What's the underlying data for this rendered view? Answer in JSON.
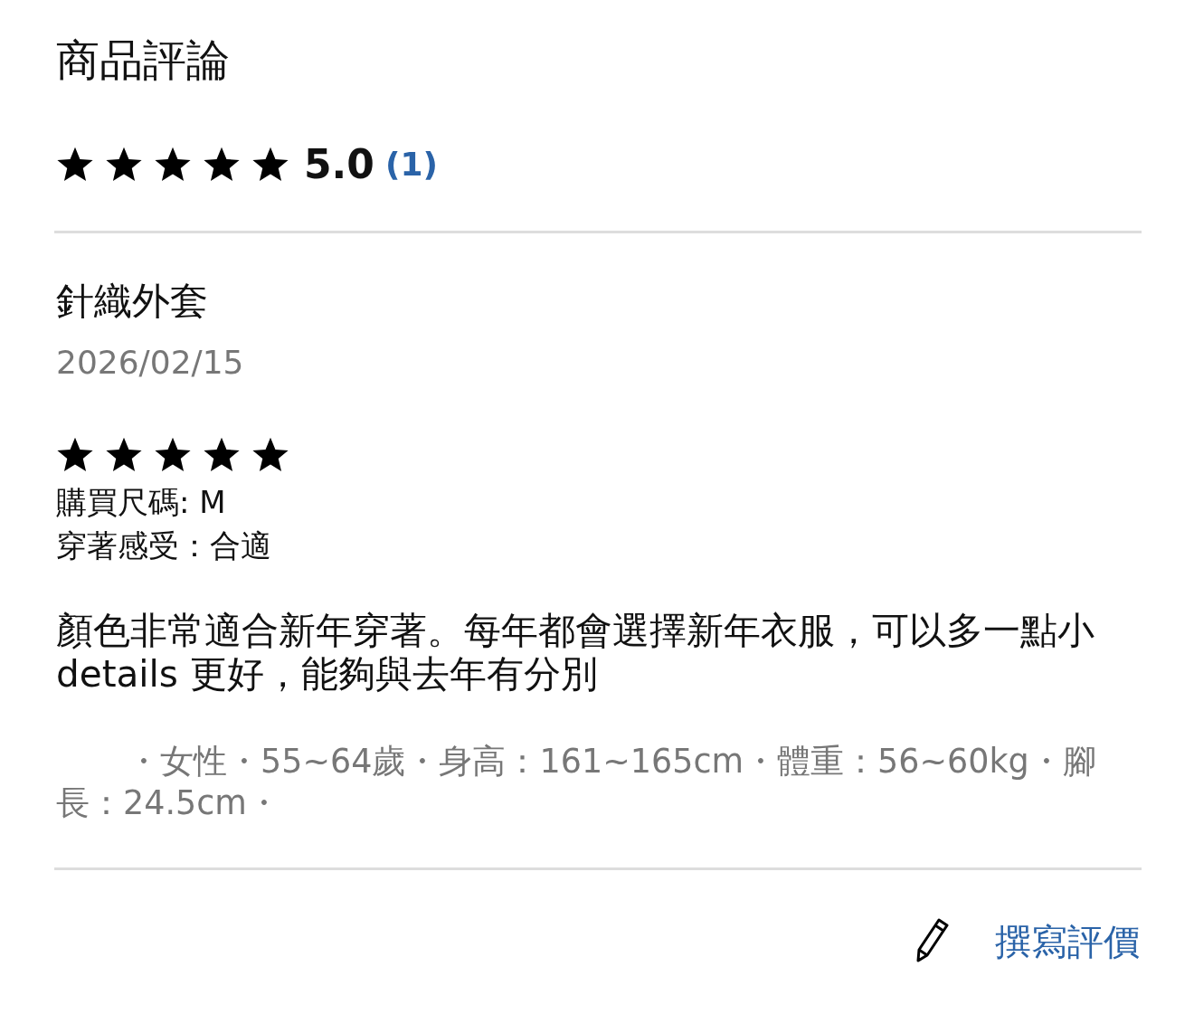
{
  "title": "商品評論",
  "summary": {
    "stars": 5,
    "score": "5.0",
    "count": "(1)"
  },
  "reviews": [
    {
      "product": "針織外套",
      "date": "2026/02/15",
      "stars": 5,
      "details": [
        "購買尺碼: M",
        "穿著感受：合適"
      ],
      "body": "顏色非常適合新年穿著。每年都會選擇新年衣服，可以多一點小 details 更好，能夠與去年有分別",
      "profile": "・女性・55~64歲・身高：161~165cm・體重：56~60kg・腳長：24.5cm・"
    }
  ],
  "write_review": {
    "label": "撰寫評價"
  }
}
